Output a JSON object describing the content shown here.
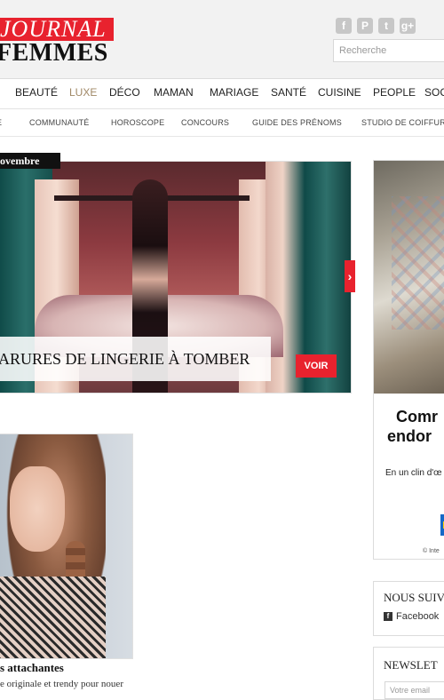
{
  "header": {
    "logo_top": "JOURNAL",
    "logo_bottom": "FEMMES",
    "search_placeholder": "Recherche",
    "social": [
      {
        "icon": "facebook-icon",
        "glyph": "f"
      },
      {
        "icon": "pinterest-icon",
        "glyph": "P"
      },
      {
        "icon": "twitter-icon",
        "glyph": "t"
      },
      {
        "icon": "google-plus-icon",
        "glyph": "g+"
      }
    ]
  },
  "main_nav": [
    "BEAUTÉ",
    "LUXE",
    "DÉCO",
    "MAMAN",
    "MARIAGE",
    "SANTÉ",
    "CUISINE",
    "PEOPLE",
    "SOC"
  ],
  "sub_nav": [
    "E",
    "COMMUNAUTÉ",
    "HOROSCOPE",
    "CONCOURS",
    "GUIDE DES PRÉNOMS",
    "STUDIO DE COIFFURE"
  ],
  "hero": {
    "date": "ovembre",
    "caption": "ARURES DE LINGERIE À TOMBER",
    "cta": "VOIR",
    "next_arrow": "›"
  },
  "ad": {
    "headline_1": "Comr",
    "headline_2": "endor",
    "body": "En un clin d'œ",
    "footer": "© Inte"
  },
  "follow_box": {
    "title": "NOUS SUIV",
    "facebook_label": "Facebook"
  },
  "newsletter_box": {
    "title": "NEWSLET",
    "email_placeholder": "Votre email"
  },
  "article_card": {
    "title": "s attachantes",
    "description": "e originale et trendy pour nouer"
  },
  "colors": {
    "brand_red": "#e8222e",
    "luxe_gold": "#a08866",
    "text_dark": "#222222"
  }
}
